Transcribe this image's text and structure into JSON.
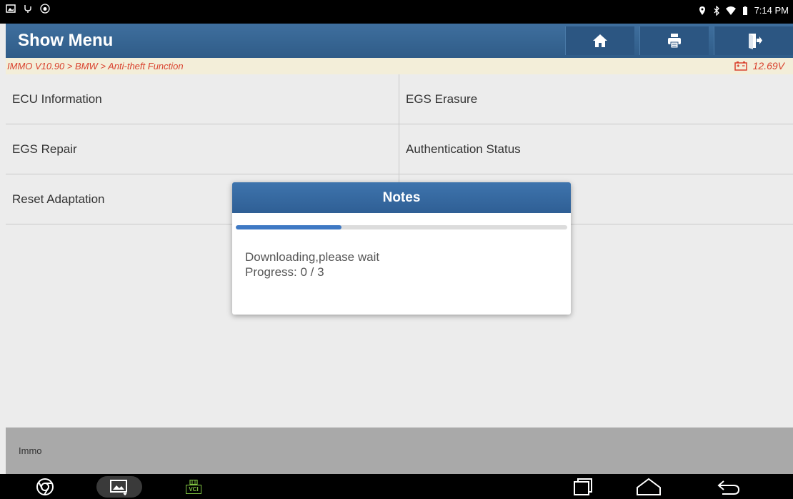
{
  "status_bar": {
    "time": "7:14 PM"
  },
  "header": {
    "title": "Show Menu",
    "buttons": [
      {
        "name": "home",
        "icon": "home-icon"
      },
      {
        "name": "print",
        "icon": "printer-icon"
      },
      {
        "name": "exit",
        "icon": "exit-icon"
      }
    ]
  },
  "breadcrumb": {
    "path": "IMMO V10.90 > BMW > Anti-theft Function",
    "voltage": "12.69V"
  },
  "menu": {
    "items": [
      "ECU Information",
      "EGS Erasure",
      "EGS Repair",
      "Authentication Status",
      "Reset Adaptation"
    ]
  },
  "footer": {
    "label": "Immo"
  },
  "dialog": {
    "title": "Notes",
    "message_line1": "Downloading,please wait",
    "message_line2": "Progress: 0 / 3",
    "progress_fraction": 0.32
  },
  "nav_bar": {
    "vci_label": "VCI"
  },
  "colors": {
    "header_blue": "#2f5c88",
    "breadcrumb_red": "#d9412d",
    "progress_blue": "#3f79c4",
    "vci_green": "#7fc241"
  }
}
